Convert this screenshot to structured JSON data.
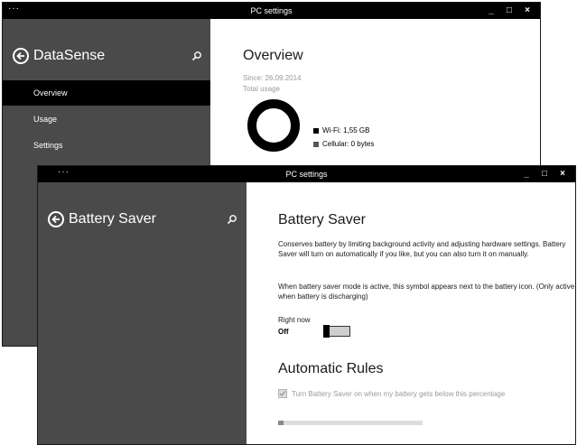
{
  "window_back": {
    "menu_glyph": "···",
    "title": "PC settings",
    "controls": {
      "minimize": "_",
      "maximize": "□",
      "close": "×"
    },
    "sidebar": {
      "title": "DataSense",
      "items": [
        {
          "label": "Overview",
          "selected": true
        },
        {
          "label": "Usage",
          "selected": false
        },
        {
          "label": "Settings",
          "selected": false
        }
      ]
    },
    "main": {
      "heading": "Overview",
      "since": "Since: 26.09.2014",
      "total_usage_label": "Total usage",
      "legend": [
        {
          "label": "Wi-Fi: 1,55 GB",
          "color": "#000000"
        },
        {
          "label": "Cellular: 0 bytes",
          "color": "#555555"
        }
      ]
    }
  },
  "window_front": {
    "menu_glyph": "···",
    "title": "PC settings",
    "controls": {
      "minimize": "_",
      "maximize": "□",
      "close": "×"
    },
    "sidebar": {
      "title": "Battery Saver"
    },
    "main": {
      "heading": "Battery Saver",
      "description_1": "Conserves battery by limiting background activity and adjusting hardware settings. Battery Saver will turn on automatically if you like, but you can also turn it on manually.",
      "description_2": "When battery saver mode is active, this symbol appears next to the battery icon. (Only active when battery is discharging)",
      "right_now_label": "Right now",
      "toggle_state": "Off",
      "toggle_on": false,
      "rules_heading": "Automatic Rules",
      "auto_checkbox_label": "Turn Battery Saver on when my battery gets below this percentage",
      "auto_checkbox_checked": true,
      "threshold_fraction": 0.04
    }
  },
  "colors": {
    "sidebar_bg": "#4a4a4a",
    "titlebar_bg": "#000000",
    "selected_nav_bg": "#000000",
    "disabled_text": "#9a9a9a"
  },
  "icons": [
    "back-arrow-icon",
    "search-icon",
    "minimize-icon",
    "maximize-icon",
    "close-icon",
    "checkmark-icon"
  ]
}
